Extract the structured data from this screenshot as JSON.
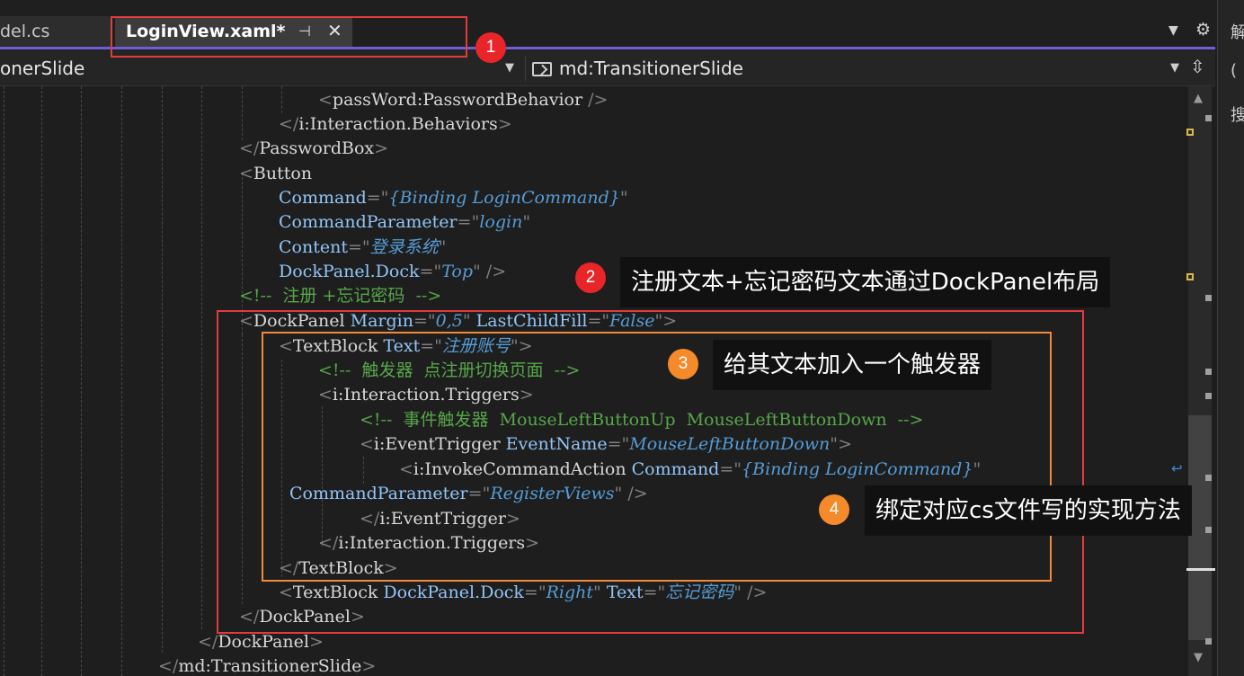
{
  "tabs": {
    "previous_label": "del.cs",
    "active_label": "LoginView.xaml*",
    "pin_icon": "pin-icon",
    "close_icon": "close-icon"
  },
  "side_panel": {
    "chars": [
      "解",
      "(",
      "搜"
    ]
  },
  "navbar": {
    "left_label": "onerSlide",
    "right_label": "md:TransitionerSlide"
  },
  "code_lines": [
    "<passWord:PasswordBehavior />",
    "</i:Interaction.Behaviors>",
    "</PasswordBox>",
    "<Button",
    "Command=\"{Binding LoginCommand}\"",
    "CommandParameter=\"login\"",
    "Content=\"登录系统\"",
    "DockPanel.Dock=\"Top\" />",
    "<!--  注册 +忘记密码  -->",
    "<DockPanel Margin=\"0,5\" LastChildFill=\"False\">",
    "<TextBlock Text=\"注册账号\">",
    "<!--  触发器  点注册切换页面  -->",
    "<i:Interaction.Triggers>",
    "<!--  事件触发器  MouseLeftButtonUp  MouseLeftButtonDown  -->",
    "<i:EventTrigger EventName=\"MouseLeftButtonDown\">",
    "<i:InvokeCommandAction Command=\"{Binding LoginCommand}\"",
    "CommandParameter=\"RegisterViews\" />",
    "</i:EventTrigger>",
    "</i:Interaction.Triggers>",
    "</TextBlock>",
    "<TextBlock DockPanel.Dock=\"Right\" Text=\"忘记密码\" />",
    "</DockPanel>",
    "</DockPanel>",
    "</md:TransitionerSlide>"
  ],
  "annotations": [
    {
      "number": "1",
      "text": ""
    },
    {
      "number": "2",
      "text": "注册文本+忘记密码文本通过DockPanel布局"
    },
    {
      "number": "3",
      "text": "给其文本加入一个触发器"
    },
    {
      "number": "4",
      "text": "绑定对应cs文件写的实现方法"
    }
  ],
  "colors": {
    "accent": "#6f5fd6",
    "annotation_red": "#e23c3c",
    "annotation_orange": "#f0893a",
    "xaml_attribute": "#92c5f8",
    "xaml_string": "#569cd6",
    "xaml_comment": "#57a64a"
  }
}
